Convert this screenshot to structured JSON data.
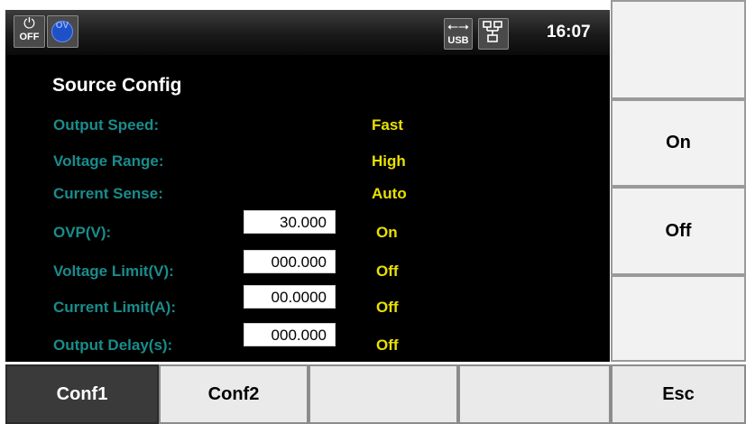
{
  "status_bar": {
    "power_label": "OFF",
    "ov_label": "OV",
    "usb_label": "USB",
    "clock": "16:07"
  },
  "page_title": "Source Config",
  "settings": [
    {
      "label": "Output Speed:",
      "value": "Fast"
    },
    {
      "label": "Voltage Range:",
      "value": "High"
    },
    {
      "label": "Current Sense:",
      "value": "Auto"
    },
    {
      "label": "OVP(V):",
      "input": "30.000",
      "state": "On"
    },
    {
      "label": "Voltage Limit(V):",
      "input": "000.000",
      "state": "Off"
    },
    {
      "label": "Current Limit(A):",
      "input": "00.0000",
      "state": "Off"
    },
    {
      "label": "Output Delay(s):",
      "input": "000.000",
      "state": "Off"
    }
  ],
  "side_keys": [
    "",
    "On",
    "Off",
    "",
    ""
  ],
  "bottom_keys": [
    "Conf1",
    "Conf2",
    "",
    "",
    "Esc"
  ],
  "colors": {
    "label_teal": "#1a8c8c",
    "value_yellow": "#e8e000",
    "screen_bg": "#000000"
  }
}
